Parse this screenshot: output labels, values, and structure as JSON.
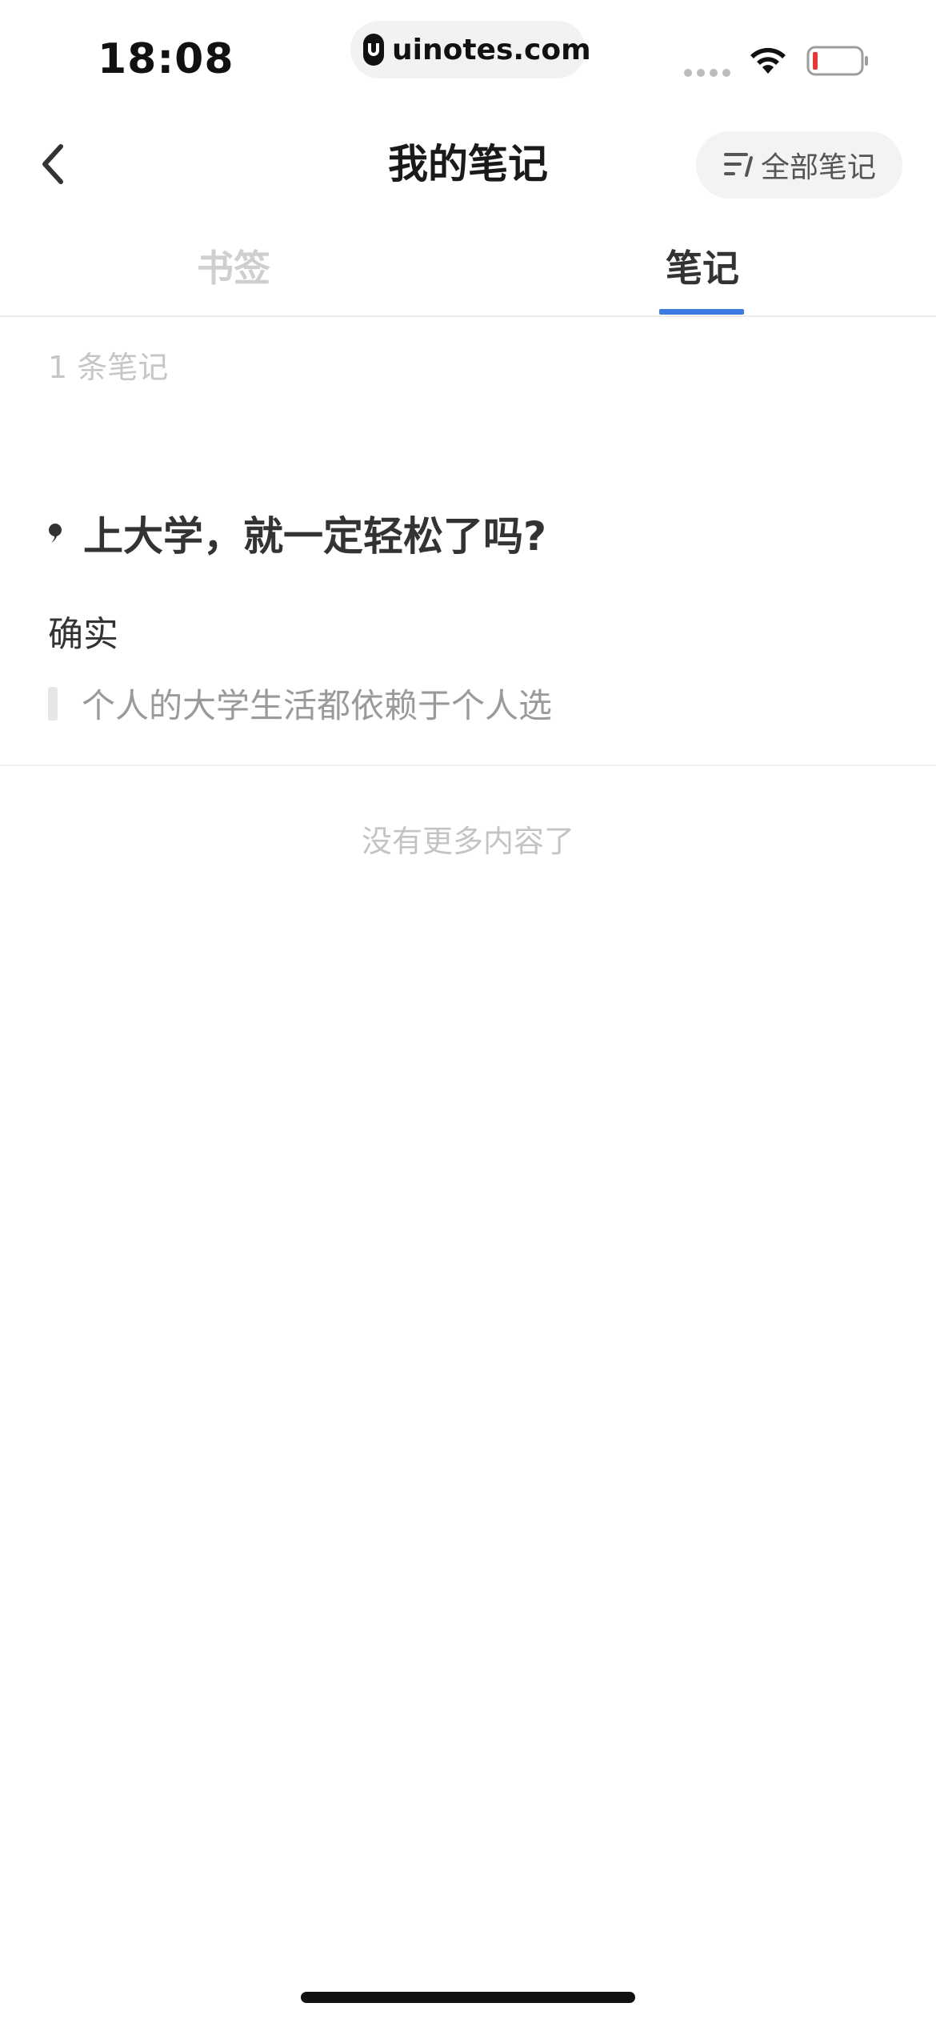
{
  "status_bar": {
    "time": "18:08",
    "url": "uinotes.com",
    "icons": [
      "uinotes-logo-icon",
      "signal-icon",
      "wifi-icon",
      "battery-icon"
    ],
    "battery_color": "#e53935"
  },
  "nav": {
    "title": "我的笔记",
    "back_icon": "chevron-left-icon",
    "filter_label": "全部笔记",
    "filter_icon": "filter-list-icon"
  },
  "tabs": {
    "items": [
      {
        "label": "书签",
        "active": false
      },
      {
        "label": "笔记",
        "active": true
      }
    ],
    "accent_color": "#3d7be0"
  },
  "content": {
    "count_label": "1 条笔记",
    "chapter_title": "上大学，就一定轻松了吗?",
    "note_text": "确实",
    "quote_text": "个人的大学生活都依赖于个人选",
    "end_label": "没有更多内容了"
  }
}
